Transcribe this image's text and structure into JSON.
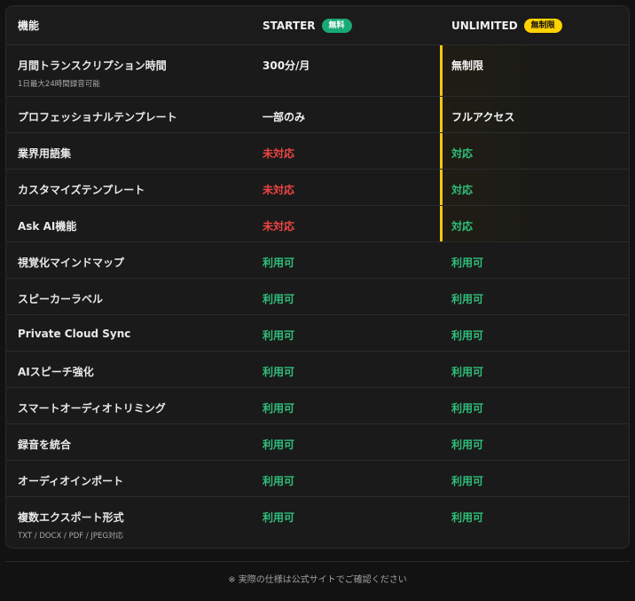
{
  "header": {
    "feature_label": "機能",
    "starter_label": "STARTER",
    "starter_badge": "無料",
    "unlimited_label": "UNLIMITED",
    "unlimited_badge": "無制限"
  },
  "rows": [
    {
      "feature": "月間トランスクリプション時間",
      "sub": "1日最大24時間録音可能",
      "starter": "300分/月",
      "unlimited": "無制限"
    },
    {
      "feature": "プロフェッショナルテンプレート",
      "starter": "一部のみ",
      "unlimited": "フルアクセス"
    },
    {
      "feature": "業界用語集",
      "starter": "未対応",
      "unlimited": "対応"
    },
    {
      "feature": "カスタマイズテンプレート",
      "starter": "未対応",
      "unlimited": "対応"
    },
    {
      "feature": "Ask AI機能",
      "starter": "未対応",
      "unlimited": "対応"
    },
    {
      "feature": "視覚化マインドマップ",
      "starter": "利用可",
      "unlimited": "利用可"
    },
    {
      "feature": "スピーカーラベル",
      "starter": "利用可",
      "unlimited": "利用可"
    },
    {
      "feature": "Private Cloud Sync",
      "starter": "利用可",
      "unlimited": "利用可"
    },
    {
      "feature": "AIスピーチ強化",
      "starter": "利用可",
      "unlimited": "利用可"
    },
    {
      "feature": "スマートオーディオトリミング",
      "starter": "利用可",
      "unlimited": "利用可"
    },
    {
      "feature": "録音を統合",
      "starter": "利用可",
      "unlimited": "利用可"
    },
    {
      "feature": "オーディオインポート",
      "starter": "利用可",
      "unlimited": "利用可"
    },
    {
      "feature": "複数エクスポート形式",
      "sub": "TXT / DOCX / PDF / JPEG対応",
      "starter": "利用可",
      "unlimited": "利用可"
    }
  ],
  "footer": {
    "note": "※ 実際の仕様は公式サイトでご確認ください"
  },
  "colors": {
    "unlimited_accent": "#f5c518",
    "free_badge": "#19a974",
    "unavailable": "#ef4444",
    "available": "#22c55e"
  }
}
